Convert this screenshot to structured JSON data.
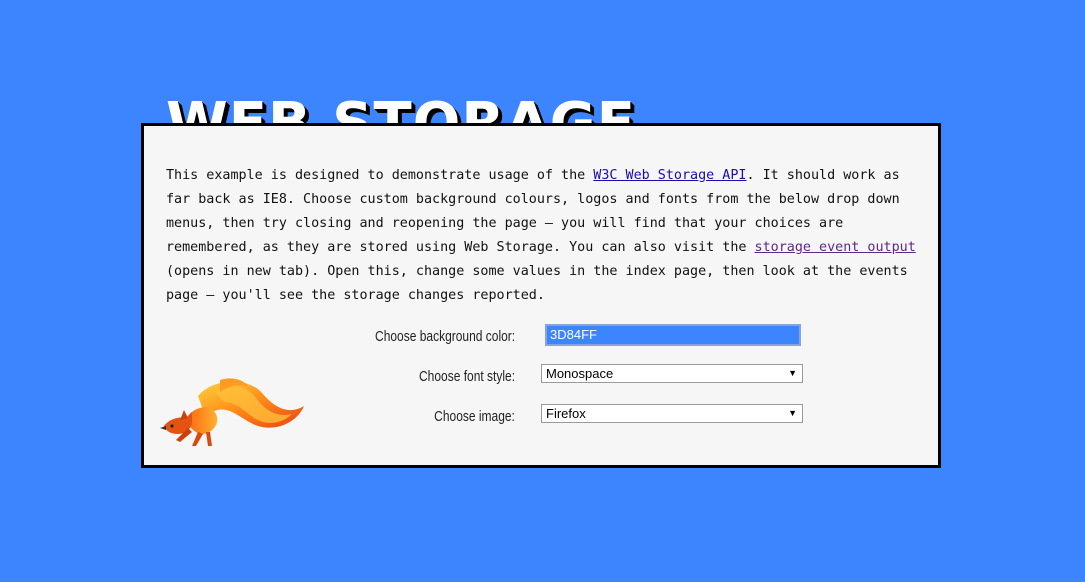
{
  "page": {
    "title": "WEB STORAGE",
    "background_color": "#3D84FF"
  },
  "intro": {
    "text_1": "This example is designed to demonstrate usage of the ",
    "link_1": "W3C Web Storage API",
    "text_2": ". It should work as far back as IE8. Choose custom background colours, logos and fonts from the below drop down menus, then try closing and reopening the page — you will find that your choices are remembered, as they are stored using Web Storage. You can also visit the ",
    "link_2": "storage event output",
    "text_3": " (opens in new tab). Open this, change some values in the index page, then look at the events page — you'll see the storage changes reported."
  },
  "form": {
    "bg_label": "Choose background color:",
    "bg_value": "3D84FF",
    "font_label": "Choose font style:",
    "font_value": "Monospace",
    "image_label": "Choose image:",
    "image_value": "Firefox"
  },
  "icons": {
    "logo": "firefox-fox-icon",
    "dropdown": "triangle-down-icon"
  }
}
